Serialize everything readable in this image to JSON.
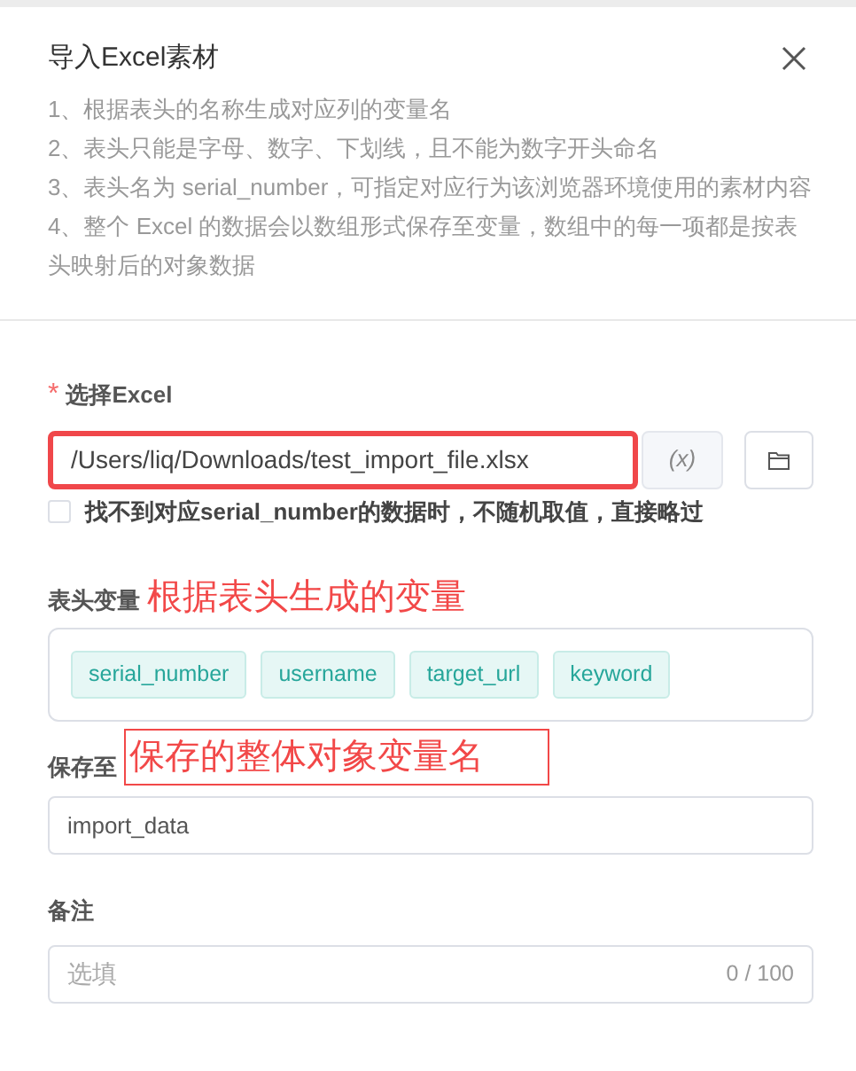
{
  "dialog": {
    "title": "导入Excel素材"
  },
  "instructions": [
    "1、根据表头的名称生成对应列的变量名",
    "2、表头只能是字母、数字、下划线，且不能为数字开头命名",
    "3、表头名为 serial_number，可指定对应行为该浏览器环境使用的素材内容",
    "4、整个 Excel 的数据会以数组形式保存至变量，数组中的每一项都是按表头映射后的对象数据"
  ],
  "file_field": {
    "required_mark": "*",
    "label": "选择Excel",
    "value": "/Users/liq/Downloads/test_import_file.xlsx",
    "highlighted": true,
    "variable_button": "(x)"
  },
  "skip_checkbox": {
    "label": "找不到对应serial_number的数据时，不随机取值，直接略过",
    "checked": false
  },
  "header_variables": {
    "label": "表头变量",
    "annotation": {
      "text": "根据表头生成的变量",
      "boxed": false
    },
    "tags": [
      "serial_number",
      "username",
      "target_url",
      "keyword"
    ]
  },
  "save_to": {
    "label": "保存至",
    "annotation": {
      "text": "保存的整体对象变量名",
      "boxed": true
    },
    "value": "import_data"
  },
  "note": {
    "label": "备注",
    "placeholder": "选填",
    "counter": "0 / 100"
  }
}
